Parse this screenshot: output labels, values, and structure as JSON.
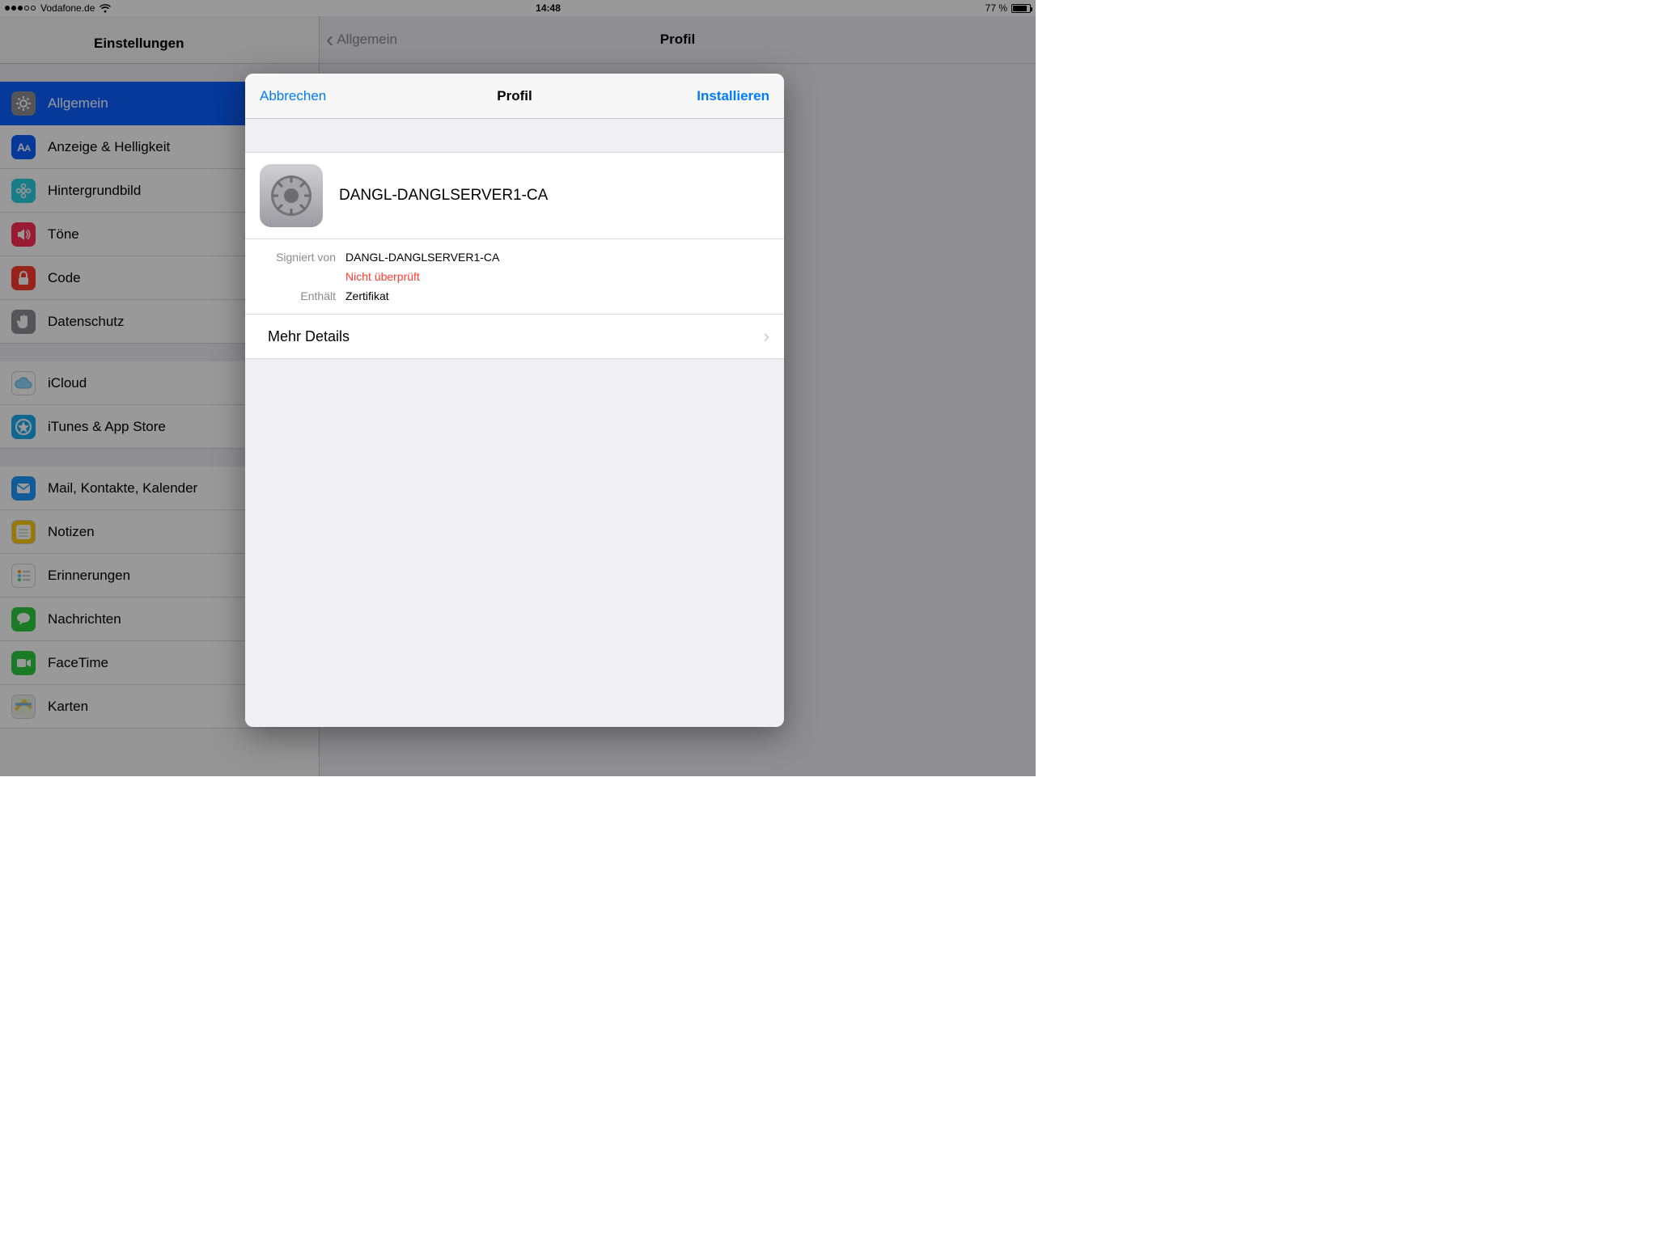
{
  "status": {
    "carrier": "Vodafone.de",
    "time": "14:48",
    "battery_pct": "77 %",
    "battery_fill_pct": 77
  },
  "sidebar": {
    "title": "Einstellungen",
    "items": [
      {
        "label": "Allgemein",
        "icon": "gear",
        "color": "#8e8e93",
        "selected": true
      },
      {
        "label": "Anzeige & Helligkeit",
        "icon": "aa",
        "color": "#0a60ff"
      },
      {
        "label": "Hintergrundbild",
        "icon": "flower",
        "color": "#2acfe0"
      },
      {
        "label": "Töne",
        "icon": "speaker",
        "color": "#ff2d55"
      },
      {
        "label": "Code",
        "icon": "lock",
        "color": "#ff3b30"
      },
      {
        "label": "Datenschutz",
        "icon": "hand",
        "color": "#8e8e93"
      }
    ],
    "group2": [
      {
        "label": "iCloud",
        "icon": "cloud",
        "color": "#ffffff"
      },
      {
        "label": "iTunes & App Store",
        "icon": "appstore",
        "color": "#1bacf0"
      }
    ],
    "group3": [
      {
        "label": "Mail, Kontakte, Kalender",
        "icon": "mail",
        "color": "#1e98ff"
      },
      {
        "label": "Notizen",
        "icon": "notes",
        "color": "#ffcc00"
      },
      {
        "label": "Erinnerungen",
        "icon": "reminders",
        "color": "#ffffff"
      },
      {
        "label": "Nachrichten",
        "icon": "messages",
        "color": "#2ecc40"
      },
      {
        "label": "FaceTime",
        "icon": "facetime",
        "color": "#2ecc40"
      },
      {
        "label": "Karten",
        "icon": "maps",
        "color": "#f0f0f0"
      }
    ]
  },
  "detail": {
    "back": "Allgemein",
    "title": "Profil"
  },
  "modal": {
    "cancel": "Abbrechen",
    "title": "Profil",
    "install": "Installieren",
    "profile_name": "DANGL-DANGLSERVER1-CA",
    "signed_by_label": "Signiert von",
    "signed_by_value": "DANGL-DANGLSERVER1-CA",
    "verification": "Nicht überprüft",
    "contains_label": "Enthält",
    "contains_value": "Zertifikat",
    "more": "Mehr Details"
  }
}
